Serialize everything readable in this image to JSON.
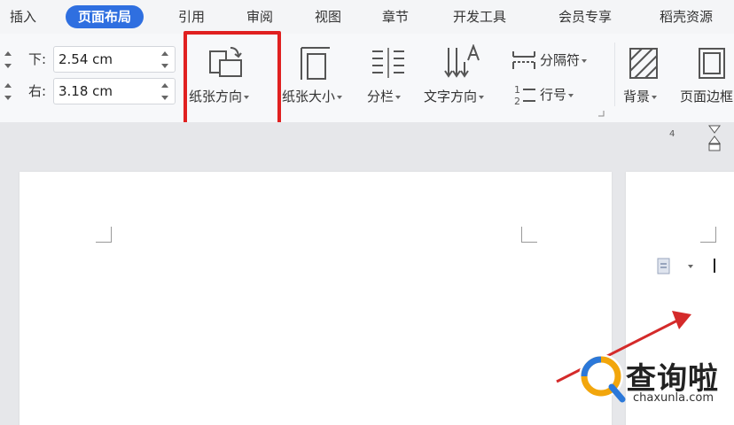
{
  "menu": {
    "tabs": [
      {
        "label": "插入"
      },
      {
        "label": "页面布局",
        "active": true
      },
      {
        "label": "引用"
      },
      {
        "label": "审阅"
      },
      {
        "label": "视图"
      },
      {
        "label": "章节"
      },
      {
        "label": "开发工具"
      },
      {
        "label": "会员专享"
      },
      {
        "label": "稻壳资源"
      }
    ]
  },
  "margins": {
    "bottom_label": "下:",
    "bottom_value": "2.54 cm",
    "right_label": "右:",
    "right_value": "3.18 cm"
  },
  "ribbon": {
    "orientation_label": "纸张方向",
    "size_label": "纸张大小",
    "columns_label": "分栏",
    "text_direction_label": "文字方向",
    "separator_label": "分隔符",
    "line_number_label": "行号",
    "background_label": "背景",
    "page_border_label": "页面边框"
  },
  "ruler": {
    "number": "4"
  },
  "watermark": {
    "text": "查询啦",
    "url": "chaxunla.com"
  },
  "colors": {
    "accent": "#2f6fe0",
    "highlight": "#e02020",
    "arrow": "#d42a2a"
  }
}
